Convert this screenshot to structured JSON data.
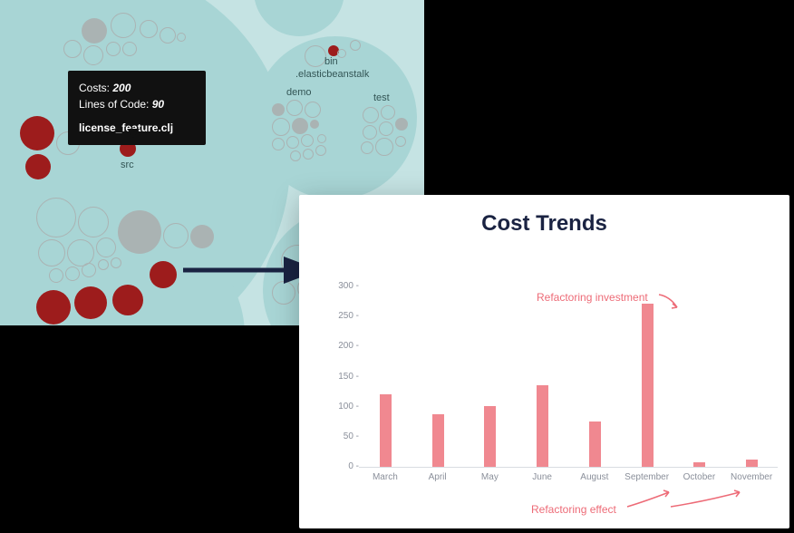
{
  "bubble_map": {
    "tooltip": {
      "line1_k": "Costs:",
      "line1_v": "200",
      "line2_k": "Lines of Code:",
      "line2_v": "90",
      "filename": "license_feature.clj"
    },
    "labels": {
      "src": "src",
      "bin": "bin",
      "elasticbeanstalk": ".elasticbeanstalk",
      "demo": "demo",
      "test": "test"
    }
  },
  "chart_data": {
    "type": "bar",
    "title": "Cost Trends",
    "xlabel": "",
    "ylabel": "",
    "categories": [
      "March",
      "April",
      "May",
      "June",
      "August",
      "September",
      "October",
      "November"
    ],
    "values": [
      120,
      87,
      100,
      135,
      75,
      270,
      8,
      12
    ],
    "yticks": [
      0,
      50,
      100,
      150,
      200,
      250,
      300
    ],
    "ylim": [
      0,
      300
    ],
    "annotations": {
      "investment": "Refactoring investment",
      "effect": "Refactoring effect"
    }
  }
}
